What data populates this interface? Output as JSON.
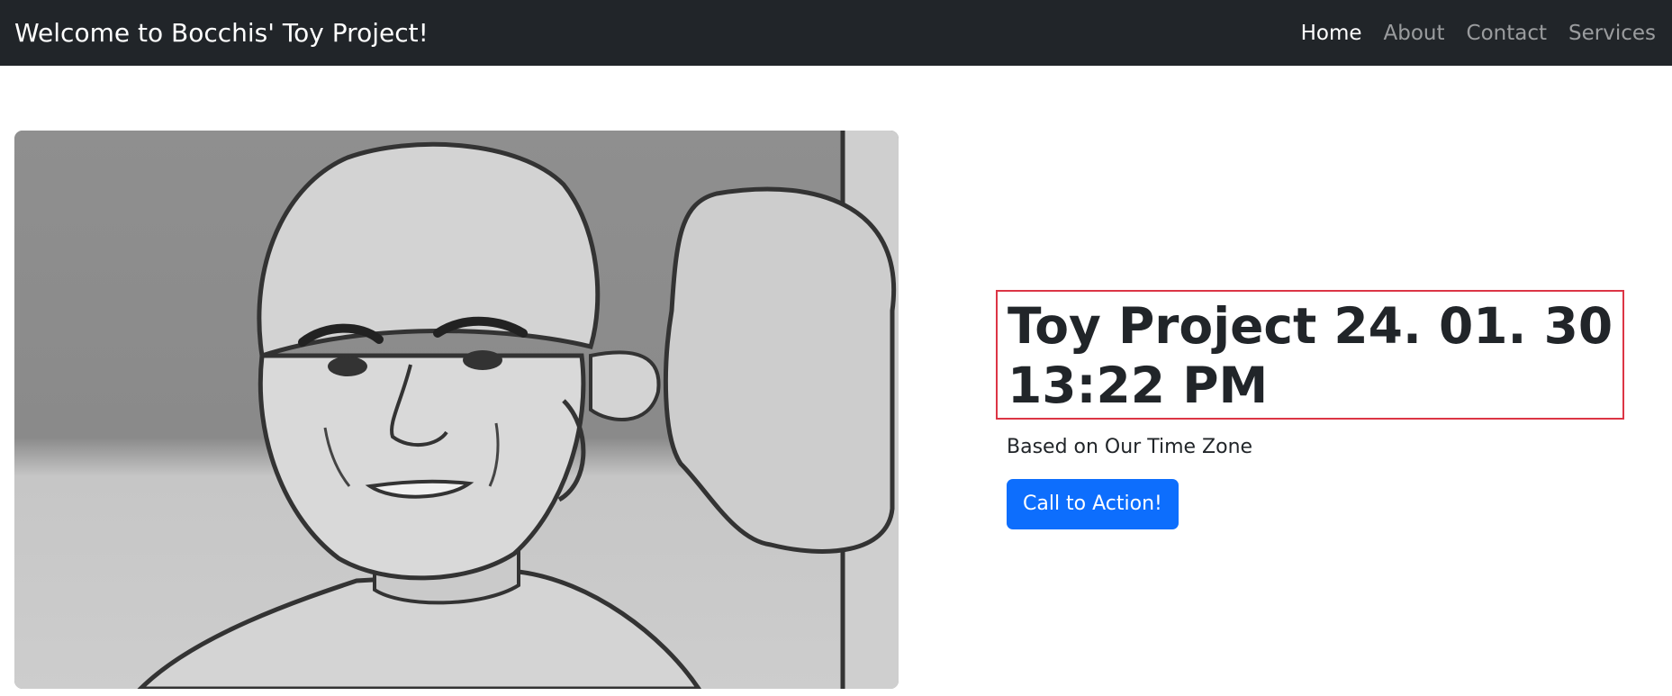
{
  "navbar": {
    "brand": "Welcome to Bocchis' Toy Project!",
    "links": [
      {
        "label": "Home",
        "active": true
      },
      {
        "label": "About",
        "active": false
      },
      {
        "label": "Contact",
        "active": false
      },
      {
        "label": "Services",
        "active": false
      }
    ]
  },
  "hero": {
    "image": {
      "icon": "manga-character-illustration"
    },
    "title_line1": "Toy Project 24. 01. 30",
    "title_line2": "13:22 PM",
    "subtitle": "Based on Our Time Zone",
    "cta_label": "Call to Action!"
  },
  "colors": {
    "navbar_bg": "#212529",
    "primary": "#0d6efd",
    "highlight_border": "#dc3545"
  }
}
